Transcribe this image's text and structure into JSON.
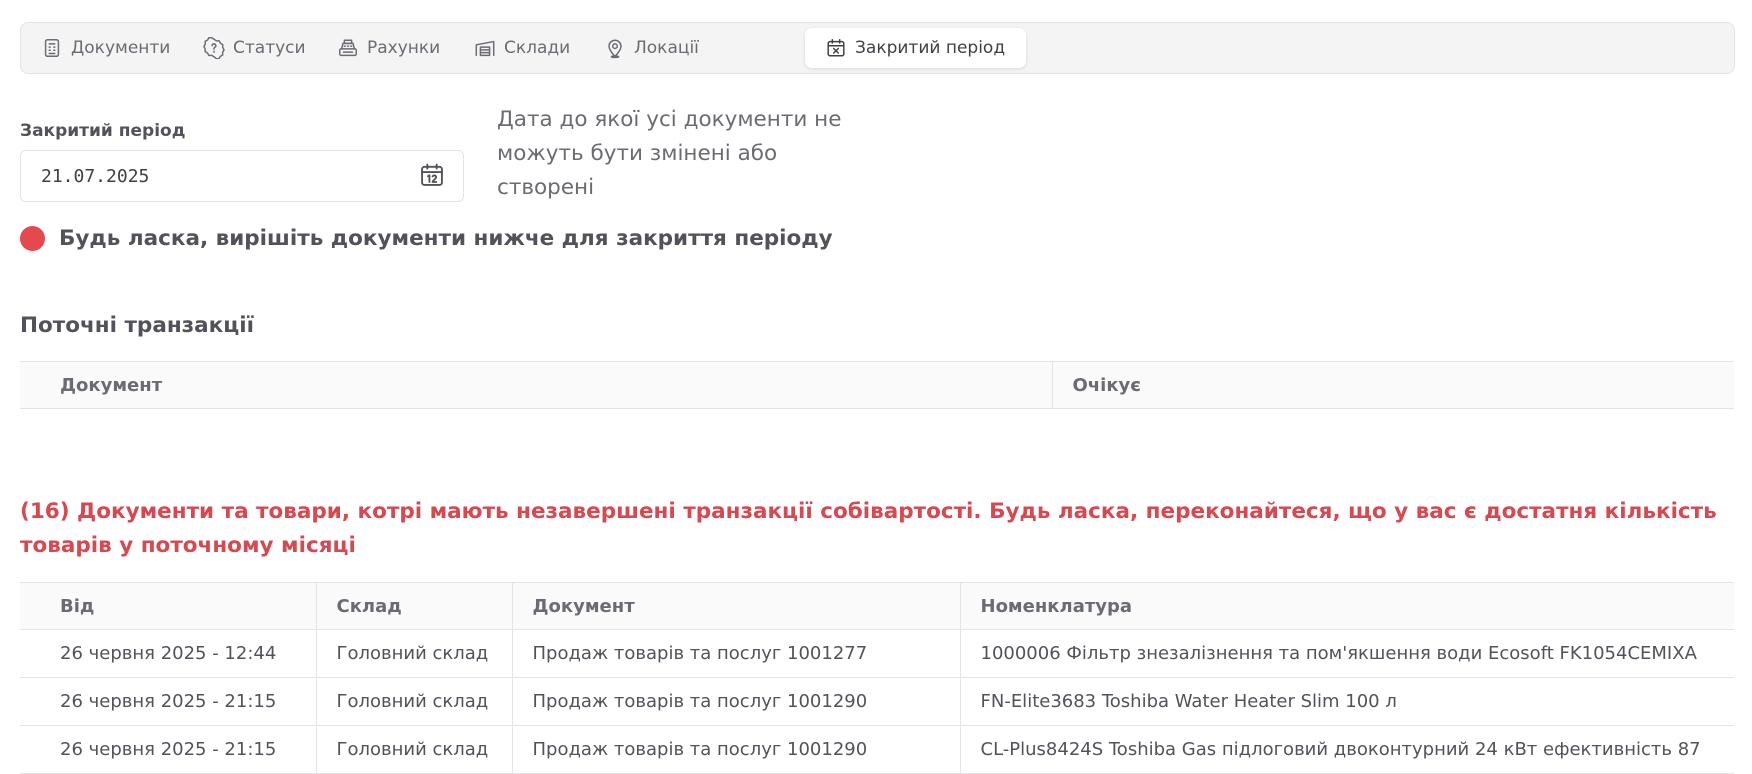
{
  "tabs": [
    {
      "label": "Документи",
      "icon": "document-icon"
    },
    {
      "label": "Статуси",
      "icon": "status-badge-icon"
    },
    {
      "label": "Рахунки",
      "icon": "cash-register-icon"
    },
    {
      "label": "Склади",
      "icon": "warehouse-icon"
    },
    {
      "label": "Локації",
      "icon": "location-pin-icon"
    },
    {
      "label": "Закритий період",
      "icon": "calendar-x-icon",
      "active": true
    }
  ],
  "closed_period": {
    "label": "Закритий період",
    "value": "21.07.2025",
    "help_text": "Дата до якої усі документи не можуть бути змінені або створені"
  },
  "warning": {
    "text": "Будь ласка, вирішіть документи нижче для закриття періоду",
    "color": "#e5484d"
  },
  "current_transactions": {
    "title": "Поточні транзакції",
    "columns": [
      "Документ",
      "Очікує"
    ],
    "rows": []
  },
  "unfinished": {
    "message": "(16) Документи та товари, котрі мають незавершені транзакції собівартості. Будь ласка, переконайтеся, що у вас є достатня кількість товарів у поточному місяці",
    "color": "#d9474f",
    "columns": [
      "Від",
      "Склад",
      "Документ",
      "Номенклатура"
    ],
    "rows": [
      [
        "26 червня 2025 - 12:44",
        "Головний склад",
        "Продаж товарів та послуг 1001277",
        "1000006 Фільтр знезалізнення та пом'якшення води Ecosoft FK1054CEMIXA"
      ],
      [
        "26 червня 2025 - 21:15",
        "Головний склад",
        "Продаж товарів та послуг 1001290",
        "FN-Elite3683 Toshiba Water Heater Slim 100 л"
      ],
      [
        "26 червня 2025 - 21:15",
        "Головний склад",
        "Продаж товарів та послуг 1001290",
        "CL-Plus8424S Toshiba Gas підлоговий двоконтурний 24 кВт ефективність 87"
      ]
    ]
  }
}
